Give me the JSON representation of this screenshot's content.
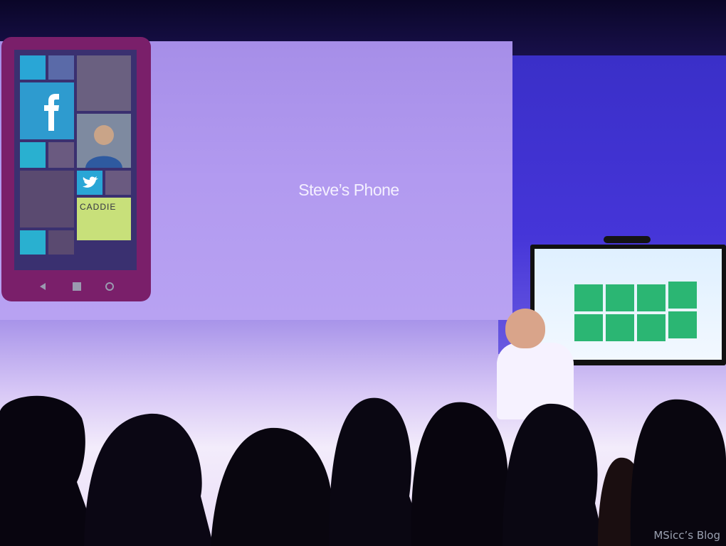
{
  "slide": {
    "title": "Steve’s Phone"
  },
  "phone_tiles": {
    "caddie_label": "CADDIE"
  },
  "watermark": {
    "text": "MSicc’s Blog"
  }
}
